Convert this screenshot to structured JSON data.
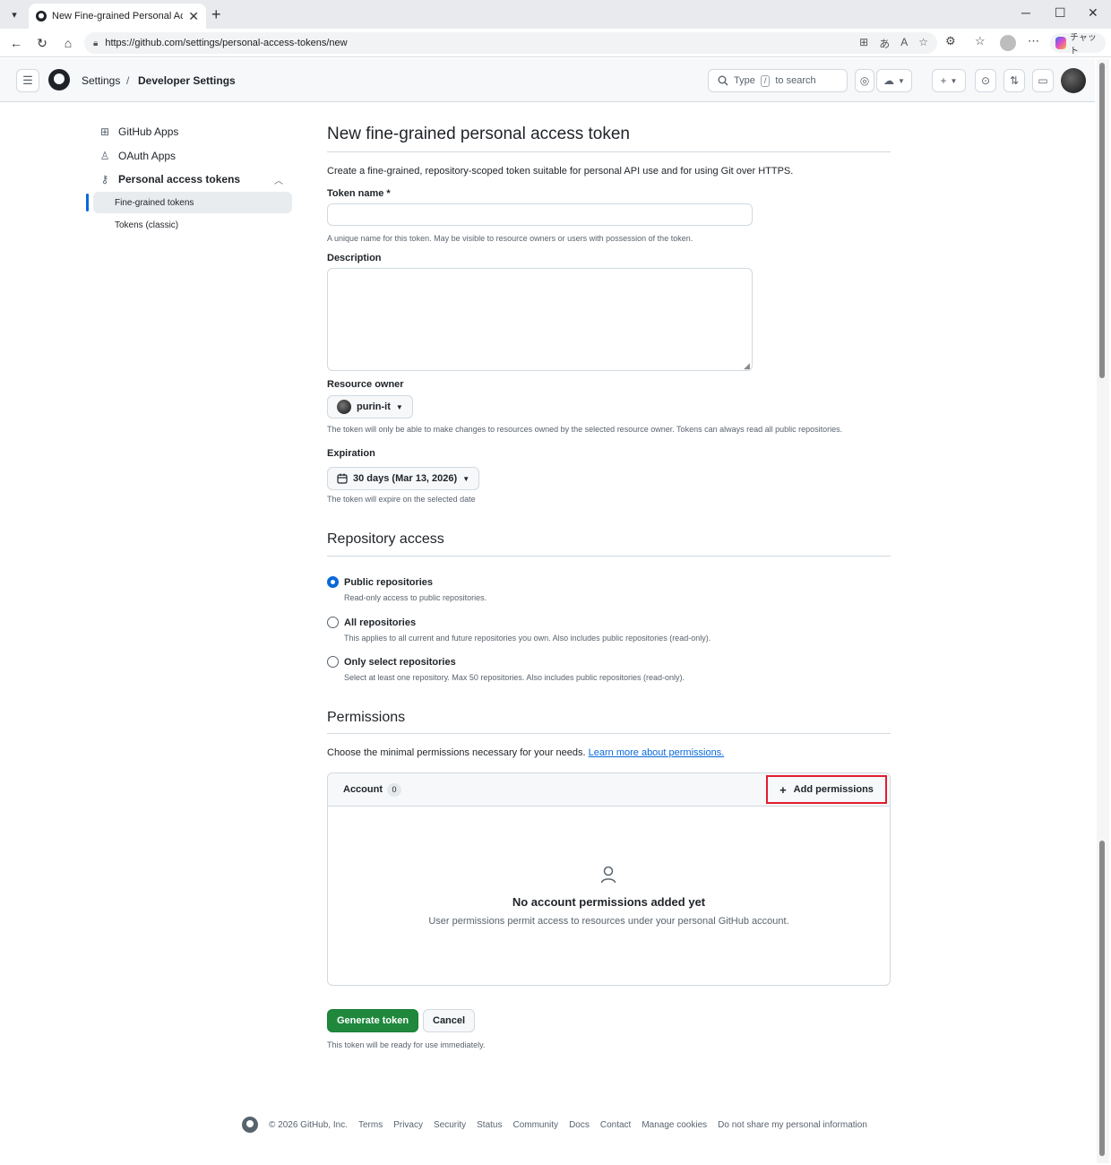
{
  "browser": {
    "tab_title": "New Fine-grained Personal Access",
    "url": "https://github.com/settings/personal-access-tokens/new",
    "copilot_label": "チャット"
  },
  "header": {
    "crumbs": [
      "Settings",
      "/",
      "Developer Settings"
    ],
    "search_prefix": "Type",
    "search_key": "/",
    "search_suffix": "to search"
  },
  "sidebar": {
    "items": [
      {
        "label": "GitHub Apps",
        "icon": "grid-icon"
      },
      {
        "label": "OAuth Apps",
        "icon": "person-icon"
      },
      {
        "label": "Personal access tokens",
        "icon": "key-icon"
      }
    ],
    "subitems": [
      "Fine-grained tokens",
      "Tokens (classic)"
    ]
  },
  "main": {
    "title": "New fine-grained personal access token",
    "intro": "Create a fine-grained, repository-scoped token suitable for personal API use and for using Git over HTTPS.",
    "token_name_label": "Token name *",
    "token_name_value": "",
    "token_name_note": "A unique name for this token. May be visible to resource owners or users with possession of the token.",
    "description_label": "Description",
    "resource_owner_label": "Resource owner",
    "resource_owner_value": "purin-it",
    "resource_owner_note": "The token will only be able to make changes to resources owned by the selected resource owner. Tokens can always read all public repositories.",
    "expiration_label": "Expiration",
    "expiration_value": "30 days (Mar 13, 2026)",
    "expiration_note": "The token will expire on the selected date",
    "repo_access_heading": "Repository access",
    "repo_options": [
      {
        "label": "Public repositories",
        "note": "Read-only access to public repositories.",
        "checked": true
      },
      {
        "label": "All repositories",
        "note": "This applies to all current and future repositories you own. Also includes public repositories (read-only).",
        "checked": false
      },
      {
        "label": "Only select repositories",
        "note": "Select at least one repository. Max 50 repositories. Also includes public repositories (read-only).",
        "checked": false
      }
    ],
    "permissions_heading": "Permissions",
    "permissions_intro": "Choose the minimal permissions necessary for your needs.",
    "permissions_link": "Learn more about permissions.",
    "account_label": "Account",
    "account_count": "0",
    "add_permissions": "Add permissions",
    "empty_title": "No account permissions added yet",
    "empty_note": "User permissions permit access to resources under your personal GitHub account.",
    "generate_button": "Generate token",
    "cancel_button": "Cancel",
    "ready_note": "This token will be ready for use immediately."
  },
  "footer": {
    "copyright": "© 2026 GitHub, Inc.",
    "links": [
      "Terms",
      "Privacy",
      "Security",
      "Status",
      "Community",
      "Docs",
      "Contact",
      "Manage cookies",
      "Do not share my personal information"
    ]
  },
  "colors": {
    "accent": "#0969da",
    "primary_button": "#1f883d",
    "highlight_box": "#e11d2e"
  }
}
